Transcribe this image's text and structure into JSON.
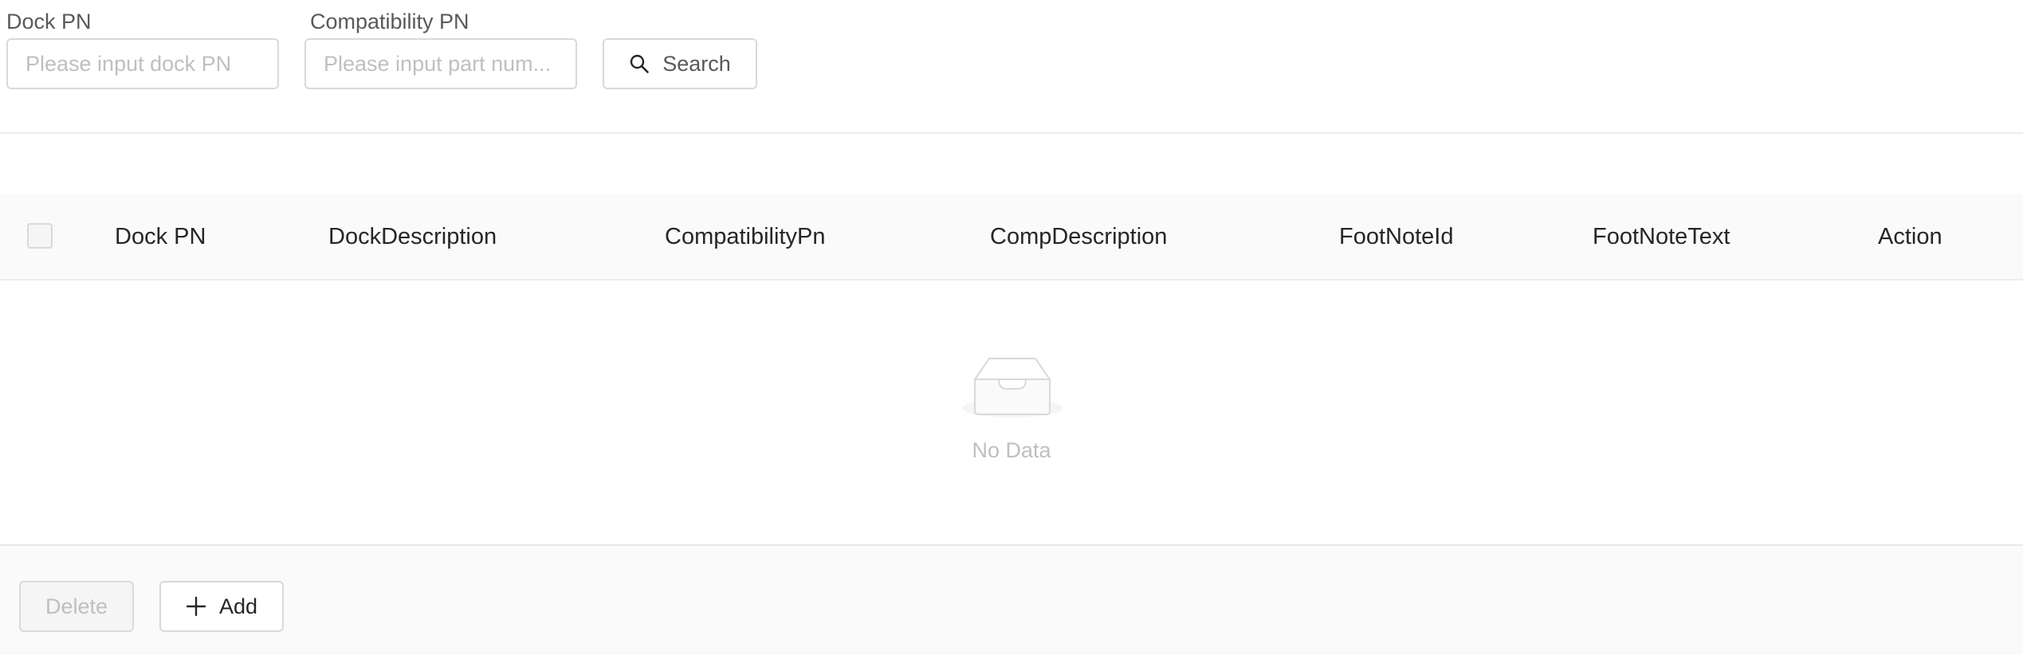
{
  "filters": {
    "dock_pn": {
      "label": "Dock PN",
      "placeholder": "Please input dock PN",
      "value": ""
    },
    "compat_pn": {
      "label": "Compatibility PN",
      "placeholder": "Please input part num...",
      "value": ""
    },
    "search_label": "Search"
  },
  "table": {
    "columns": [
      "Dock PN",
      "DockDescription",
      "CompatibilityPn",
      "CompDescription",
      "FootNoteId",
      "FootNoteText",
      "Action"
    ],
    "rows": [],
    "empty_text": "No Data"
  },
  "footer": {
    "delete_label": "Delete",
    "add_label": "Add"
  },
  "icons": {
    "search": "search-icon",
    "empty": "empty-inbox-icon",
    "add": "plus-icon"
  },
  "colors": {
    "border": "#d9d9d9",
    "header_bg": "#fafafa",
    "placeholder": "#bfbfbf",
    "muted_text": "#595959"
  }
}
